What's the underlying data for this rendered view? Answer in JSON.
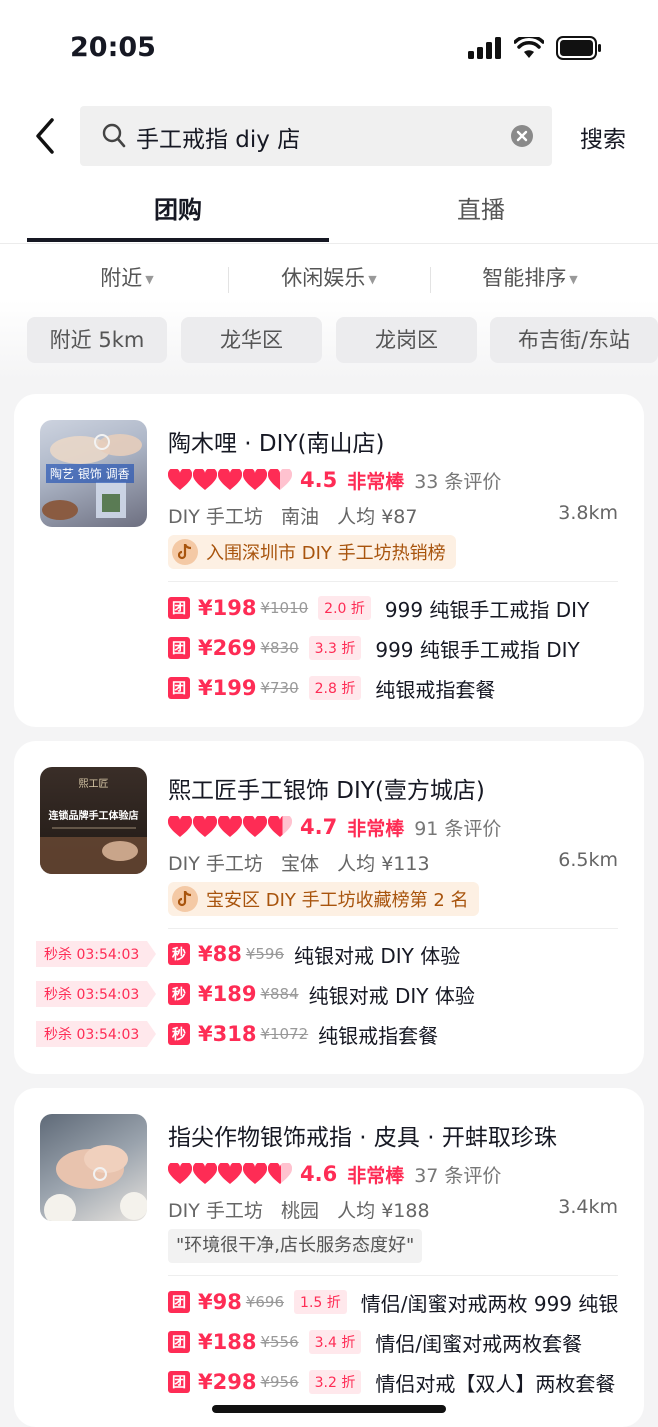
{
  "status_bar": {
    "time": "20:05"
  },
  "search": {
    "query": "手工戒指 diy 店",
    "button": "搜索"
  },
  "tabs": [
    {
      "label": "团购"
    },
    {
      "label": "直播"
    }
  ],
  "filters": [
    {
      "label": "附近"
    },
    {
      "label": "休闲娱乐"
    },
    {
      "label": "智能排序"
    }
  ],
  "chips": [
    {
      "label": "附近 5km"
    },
    {
      "label": "龙华区"
    },
    {
      "label": "龙岗区"
    },
    {
      "label": "布吉街/东站"
    }
  ],
  "shops": [
    {
      "name": "陶木哩 · DIY(南山店)",
      "thumb_text": "陶艺 银饰 调香",
      "score": "4.5",
      "grade": "非常棒",
      "reviews": "33 条评价",
      "category": "DIY 手工坊",
      "area": "南油",
      "avg": "人均 ¥87",
      "distance": "3.8km",
      "badge": "入围深圳市 DIY 手工坊热销榜",
      "deals": [
        {
          "icon": "团",
          "price": "¥198",
          "orig": "¥1010",
          "disc": "2.0 折",
          "title": "999 纯银手工戒指 DIY"
        },
        {
          "icon": "团",
          "price": "¥269",
          "orig": "¥830",
          "disc": "3.3 折",
          "title": "999 纯银手工戒指 DIY"
        },
        {
          "icon": "团",
          "price": "¥199",
          "orig": "¥730",
          "disc": "2.8 折",
          "title": "纯银戒指套餐"
        }
      ]
    },
    {
      "name": "熙工匠手工银饰 DIY(壹方城店)",
      "thumb_text": "连锁品牌手工体验店",
      "thumb_brand": "熙工匠",
      "score": "4.7",
      "grade": "非常棒",
      "reviews": "91 条评价",
      "category": "DIY 手工坊",
      "area": "宝体",
      "avg": "人均 ¥113",
      "distance": "6.5km",
      "badge": "宝安区 DIY 手工坊收藏榜第 2 名",
      "deals": [
        {
          "icon": "秒",
          "flash": "秒杀 03:54:03",
          "price": "¥88",
          "orig": "¥596",
          "title": "纯银对戒 DIY 体验"
        },
        {
          "icon": "秒",
          "flash": "秒杀 03:54:03",
          "price": "¥189",
          "orig": "¥884",
          "title": "纯银对戒 DIY 体验"
        },
        {
          "icon": "秒",
          "flash": "秒杀 03:54:03",
          "price": "¥318",
          "orig": "¥1072",
          "title": "纯银戒指套餐"
        }
      ]
    },
    {
      "name": "指尖作物银饰戒指 · 皮具 · 开蚌取珍珠",
      "score": "4.6",
      "grade": "非常棒",
      "reviews": "37 条评价",
      "category": "DIY 手工坊",
      "area": "桃园",
      "avg": "人均 ¥188",
      "distance": "3.4km",
      "quote": "\"环境很干净,店长服务态度好\"",
      "deals": [
        {
          "icon": "团",
          "price": "¥98",
          "orig": "¥696",
          "disc": "1.5 折",
          "title": "情侣/闺蜜对戒两枚 999 纯银"
        },
        {
          "icon": "团",
          "price": "¥188",
          "orig": "¥556",
          "disc": "3.4 折",
          "title": "情侣/闺蜜对戒两枚套餐"
        },
        {
          "icon": "团",
          "price": "¥298",
          "orig": "¥956",
          "disc": "3.2 折",
          "title": "情侣对戒【双人】两枚套餐"
        }
      ]
    }
  ],
  "colors": {
    "accent": "#fe2c55",
    "badge_text": "#a8540d"
  }
}
